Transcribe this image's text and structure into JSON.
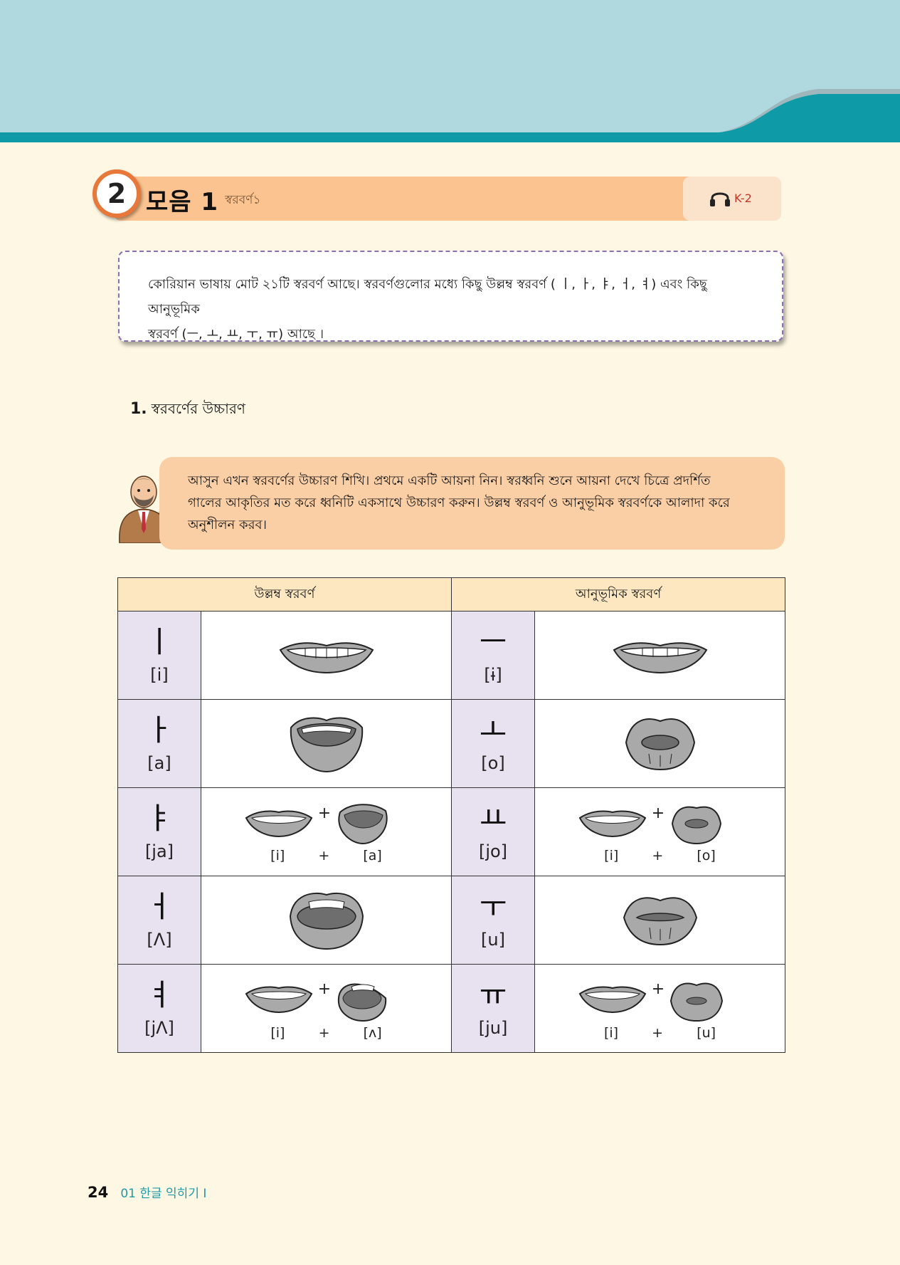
{
  "section": {
    "number": "2",
    "title": "모음 1",
    "subtitle": "স্বরবর্ণ১",
    "audio_code": "K-2"
  },
  "intro": {
    "line1": "কোরিয়ান ভাষায় মোট ২১টি স্বরবর্ণ আছে। স্বরবর্ণগুলোর মধ্যে কিছু উল্লম্ব স্বরবর্ণ ( ㅣ, ㅏ, ㅑ, ㅓ, ㅕ) এবং কিছু আনুভূমিক",
    "line2": "স্বরবর্ণ (ㅡ, ㅗ, ㅛ, ㅜ, ㅠ) আছে ।"
  },
  "subsection": {
    "number": "1.",
    "title": "স্বরবর্ণের উচ্চারণ"
  },
  "callout": {
    "line1": "আসুন এখন স্বরবর্ণের উচ্চারণ শিখি। প্রথমে একটি আয়না নিন। স্বরধ্বনি শুনে আয়না দেখে চিত্রে প্রদর্শিত",
    "line2": "গালের আকৃতির মত করে ধ্বনিটি একসাথে উচ্চারণ করুন। উল্লম্ব স্বরবর্ণ ও আনুভূমিক স্বরবর্ণকে আলাদা করে",
    "line3": "অনুশীলন করব।"
  },
  "table": {
    "headers": [
      "উল্লম্ব স্বরবর্ণ",
      "আনুভূমিক স্বরবর্ণ"
    ],
    "rows": [
      {
        "v_jamo": "ㅣ",
        "v_ipa": "[i]",
        "h_jamo": "ㅡ",
        "h_ipa": "[ɨ]"
      },
      {
        "v_jamo": "ㅏ",
        "v_ipa": "[a]",
        "h_jamo": "ㅗ",
        "h_ipa": "[o]"
      },
      {
        "v_jamo": "ㅑ",
        "v_ipa": "[ja]",
        "h_jamo": "ㅛ",
        "h_ipa": "[jo]",
        "v_combo": [
          "[i]",
          "+",
          "[a]"
        ],
        "h_combo": [
          "[i]",
          "+",
          "[o]"
        ]
      },
      {
        "v_jamo": "ㅓ",
        "v_ipa": "[Λ]",
        "h_jamo": "ㅜ",
        "h_ipa": "[u]"
      },
      {
        "v_jamo": "ㅕ",
        "v_ipa": "[jΛ]",
        "h_jamo": "ㅠ",
        "h_ipa": "[ju]",
        "v_combo": [
          "[i]",
          "+",
          "[ʌ]"
        ],
        "h_combo": [
          "[i]",
          "+",
          "[u]"
        ]
      }
    ],
    "plus_sign": "+"
  },
  "footer": {
    "page": "24",
    "chapter": "01 한글 익히기 Ⅰ"
  }
}
